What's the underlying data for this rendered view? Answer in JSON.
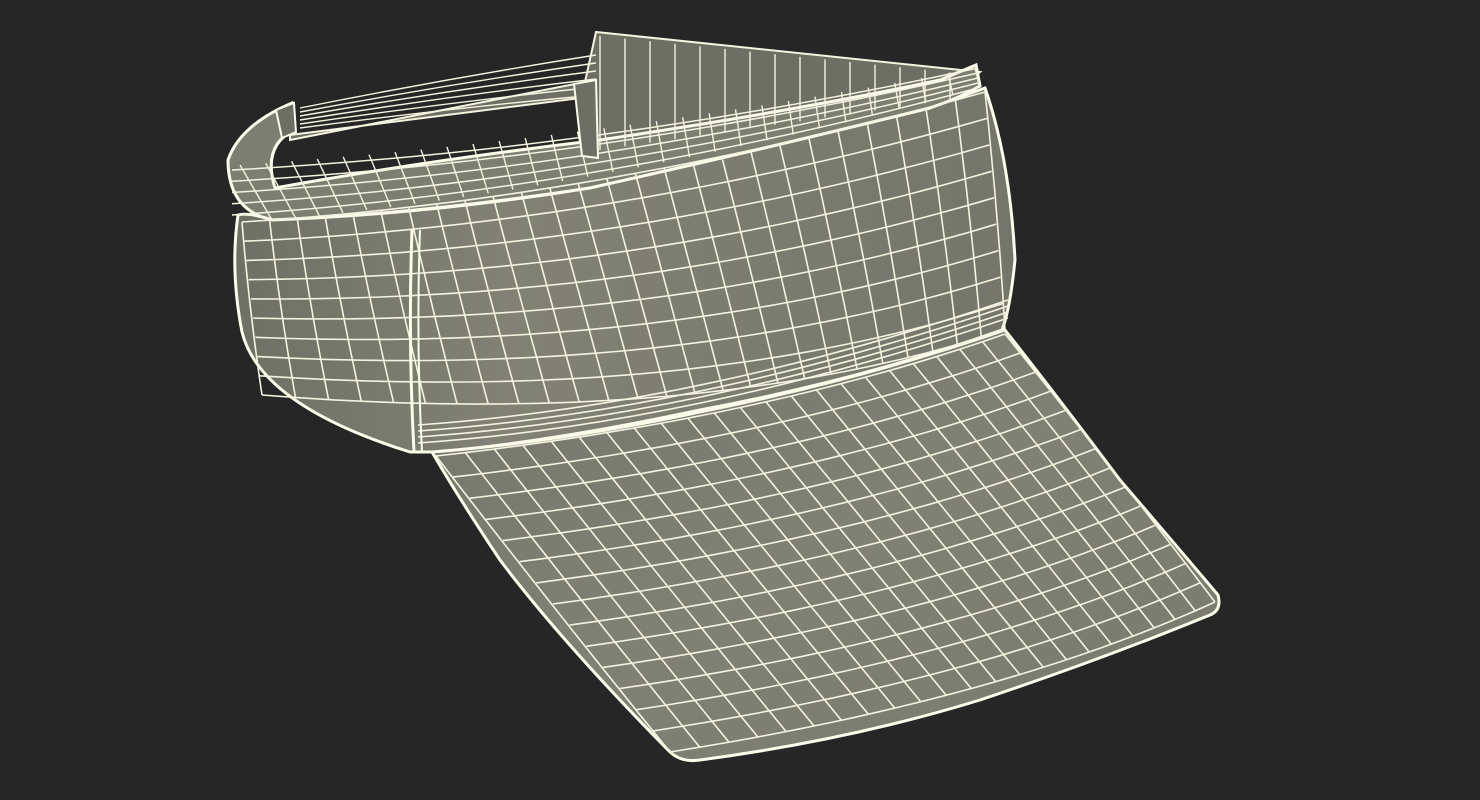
{
  "scene": {
    "subject": "sun-visor-wireframe",
    "colors": {
      "background": "#262626",
      "surface": "#7b7c70",
      "surface_light": "#8a8b7f",
      "surface_dark": "#6a6b60",
      "wire": "#f4f3e0",
      "edge": "#fbfbea"
    }
  }
}
